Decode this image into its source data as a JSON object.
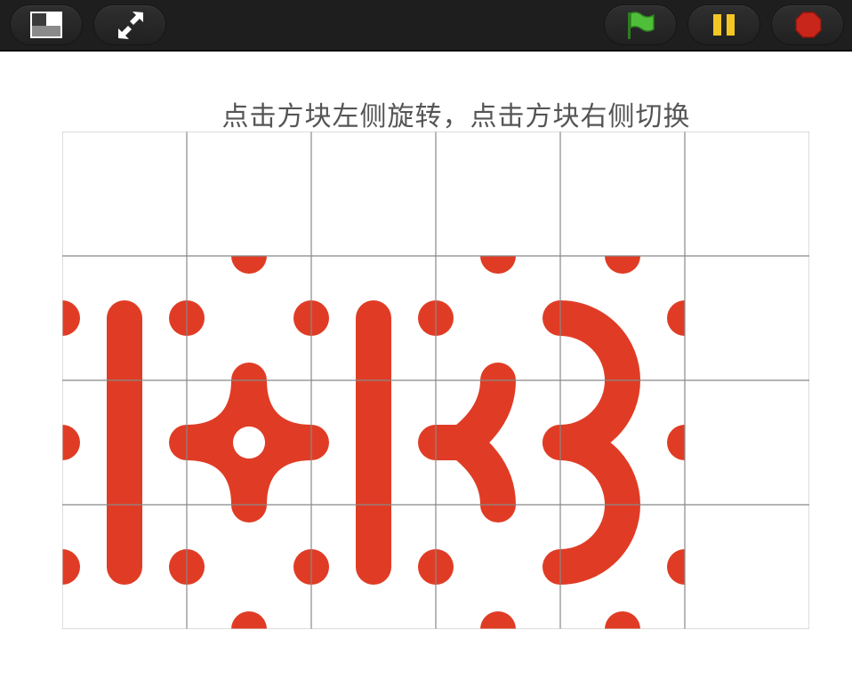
{
  "toolbar": {
    "buttons": [
      {
        "name": "layout-toggle-button",
        "icon": "layout-icon"
      },
      {
        "name": "fullscreen-button",
        "icon": "expand-arrows-icon"
      },
      {
        "name": "green-flag-button",
        "icon": "green-flag-icon"
      },
      {
        "name": "pause-button",
        "icon": "pause-icon"
      },
      {
        "name": "stop-button",
        "icon": "stop-icon"
      }
    ]
  },
  "game": {
    "instruction": "点击方块左侧旋转，点击方块右侧切换",
    "grid": {
      "rows": 4,
      "cols": 6
    },
    "colors": {
      "piece": "#e03c25",
      "grid_line": "#888888",
      "grid_line_light": "#c8c8c8",
      "background": "#ffffff",
      "flag": "#4fbf3a",
      "pause": "#f3c623",
      "stop": "#c8261b"
    },
    "tiles": [
      {
        "row": 0,
        "col": 0,
        "type": "empty"
      },
      {
        "row": 0,
        "col": 1,
        "type": "empty"
      },
      {
        "row": 0,
        "col": 2,
        "type": "empty"
      },
      {
        "row": 0,
        "col": 3,
        "type": "empty"
      },
      {
        "row": 0,
        "col": 4,
        "type": "empty"
      },
      {
        "row": 0,
        "col": 5,
        "type": "empty"
      },
      {
        "row": 1,
        "col": 0,
        "type": "line-pattern"
      },
      {
        "row": 1,
        "col": 1,
        "type": "curve-pattern"
      },
      {
        "row": 1,
        "col": 2,
        "type": "line-pattern"
      },
      {
        "row": 1,
        "col": 3,
        "type": "curve-pattern"
      },
      {
        "row": 1,
        "col": 4,
        "type": "curve-pattern"
      },
      {
        "row": 1,
        "col": 5,
        "type": "empty"
      },
      {
        "row": 2,
        "col": 0,
        "type": "line-pattern"
      },
      {
        "row": 2,
        "col": 1,
        "type": "curve-pattern"
      },
      {
        "row": 2,
        "col": 2,
        "type": "line-pattern"
      },
      {
        "row": 2,
        "col": 3,
        "type": "curve-pattern"
      },
      {
        "row": 2,
        "col": 4,
        "type": "curve-pattern"
      },
      {
        "row": 2,
        "col": 5,
        "type": "empty"
      },
      {
        "row": 3,
        "col": 0,
        "type": "line-pattern"
      },
      {
        "row": 3,
        "col": 1,
        "type": "curve-pattern"
      },
      {
        "row": 3,
        "col": 2,
        "type": "line-pattern"
      },
      {
        "row": 3,
        "col": 3,
        "type": "curve-pattern"
      },
      {
        "row": 3,
        "col": 4,
        "type": "curve-pattern"
      },
      {
        "row": 3,
        "col": 5,
        "type": "empty"
      }
    ]
  }
}
